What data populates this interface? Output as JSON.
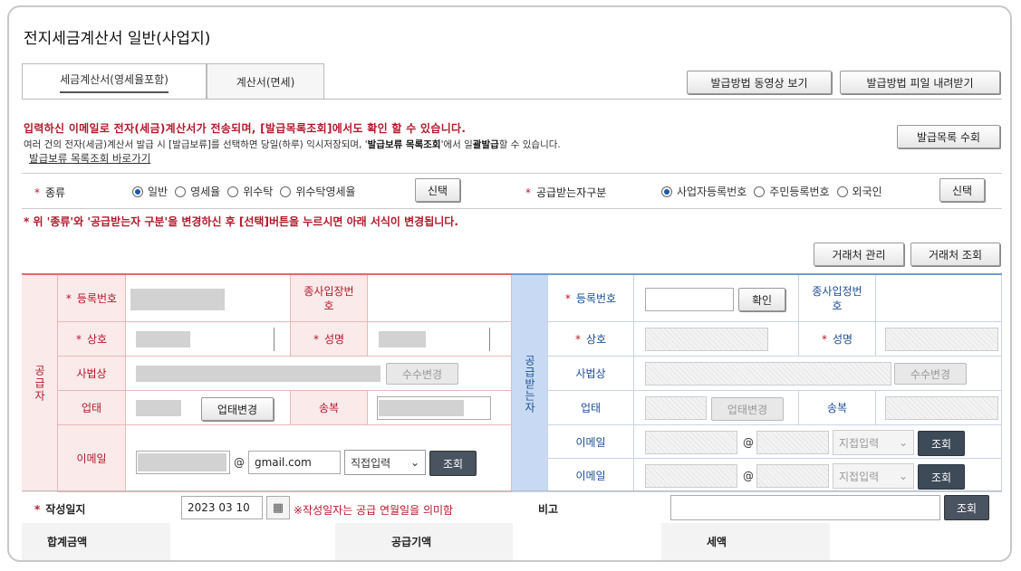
{
  "page": {
    "title": "전지세금계산서 일반(사업지)"
  },
  "tabs": [
    {
      "label": "세금계산서(영세율포함)"
    },
    {
      "label": "계산서(면세)"
    }
  ],
  "top_buttons": {
    "video": "발급방법 동영상 보기",
    "file": "발급방법 피일 내려받기",
    "list": "발급목록 수회"
  },
  "notice": {
    "line1": "입력하신 이메일로 전자(세금)계산서가 전송되며, [발급목록조회]에서도 확인 할 수 있습니다.",
    "line2_a": "여러 건의 전자(세금)계산서 발급 시 [발급보류]를 선택하면 당일(하루) 익시저장되며, '",
    "line2_b": "발급보류 목록조회",
    "line2_c": "'에서 일",
    "line2_d": "괄발급",
    "line2_e": "할 수 있습니다.",
    "link": "발급보류 목록조회 바로가기",
    "line3": "* 위 '종류'와 '공급받는자 구분'을 변경하신 후 [선택]버튼을 누르시면 아래 서식이 변경됩니다."
  },
  "kind": {
    "label": "종류",
    "options": [
      "일반",
      "영세율",
      "위수탁",
      "위수탁영세율"
    ],
    "selected": "일반",
    "button": "신택"
  },
  "receiver_type": {
    "label": "공급받는자구분",
    "options": [
      "사업자등록번호",
      "주민등록번호",
      "외국인"
    ],
    "selected": "사업자등록번호",
    "button": "신택"
  },
  "partner_buttons": {
    "manage": "거래처 관리",
    "search": "거래처 조회"
  },
  "supplier": {
    "side_label": "공급자",
    "reg_no": "등록번호",
    "branch_no": "종사입장번호",
    "name": "상호",
    "ceo": "성명",
    "address": "사법상",
    "address_btn": "수수변경",
    "biz_type": "업태",
    "biz_type_btn": "업태변경",
    "biz_item": "송복",
    "email": "이메일",
    "email_domain": "gmail.com",
    "email_select": "직접입력",
    "email_btn": "조회",
    "at": "@"
  },
  "receiver": {
    "side_label": "공급받는자",
    "reg_no": "등록번호",
    "confirm_btn": "확인",
    "branch_no": "종사입정번호",
    "name": "상호",
    "ceo": "성명",
    "address": "사법상",
    "address_btn": "수수변경",
    "biz_type": "업태",
    "biz_type_btn": "업태변경",
    "biz_item": "송복",
    "email": "이메일",
    "email_select": "지접입력",
    "email_btn": "조회",
    "at": "@"
  },
  "write_date": {
    "label": "작성일지",
    "value": "2023 03 10",
    "note": "※작성일자는 공급 연월일을 의미함"
  },
  "memo": {
    "label": "비고",
    "button": "조회"
  },
  "totals": {
    "total": "합계금액",
    "supply": "공급기액",
    "tax": "세액"
  }
}
